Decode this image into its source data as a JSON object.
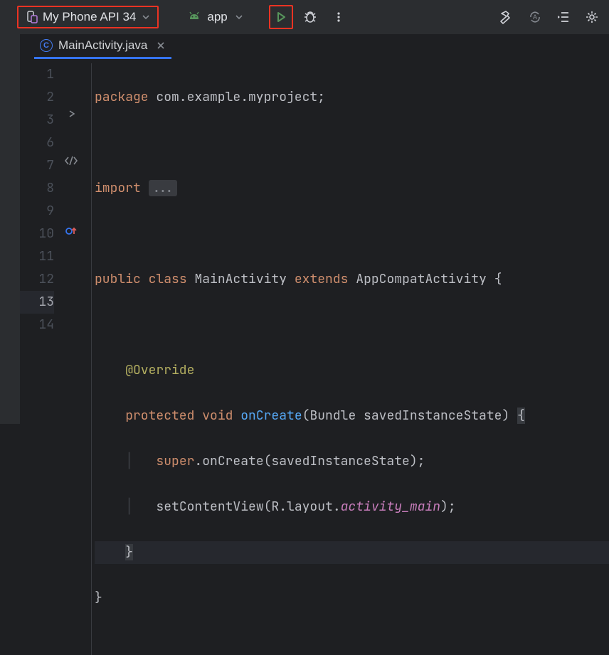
{
  "toolbar": {
    "device": "My Phone API 34",
    "module": "app"
  },
  "tab": {
    "filename": "MainActivity.java",
    "icon_letter": "C"
  },
  "lines": [
    "1",
    "2",
    "3",
    "6",
    "7",
    "8",
    "9",
    "10",
    "11",
    "12",
    "13",
    "14"
  ],
  "code": {
    "l1_kw": "package",
    "l1_rest": " com.example.myproject;",
    "l3_kw": "import",
    "l3_ellipsis": "...",
    "l7_public": "public",
    "l7_class": "class",
    "l7_name": "MainActivity",
    "l7_extends": "extends",
    "l7_super": "AppCompatActivity",
    "l7_brace": " {",
    "l9_ann": "@Override",
    "l10_protected": "protected",
    "l10_void": "void",
    "l10_fn": "onCreate",
    "l10_params": "(Bundle savedInstanceState) ",
    "l10_brace": "{",
    "l11_super": "super",
    "l11_rest": ".onCreate(savedInstanceState);",
    "l12_call": "setContentView(R.layout.",
    "l12_ital": "activity_main",
    "l12_end": ");",
    "l13_brace": "}",
    "l14_brace": "}"
  }
}
